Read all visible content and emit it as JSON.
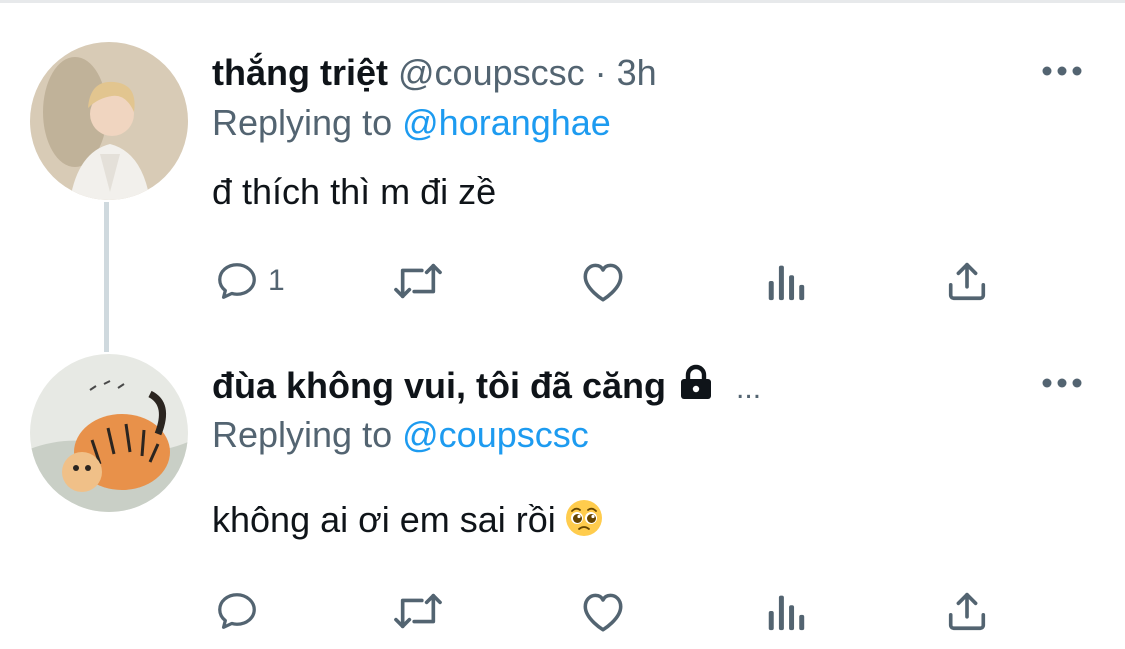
{
  "tweets": [
    {
      "display_name": "thắng triệt",
      "handle": "@coupscsc",
      "separator": "·",
      "time": "3h",
      "replying_prefix": "Replying to",
      "replying_to": "@horanghae",
      "text": "đ thích thì m đi zề",
      "reply_count": "1"
    },
    {
      "display_name": "đùa không vui, tôi đã căng",
      "name_overflow": "...",
      "replying_prefix": "Replying to",
      "replying_to": "@coupscsc",
      "text": "không ai ơi em sai rồi"
    }
  ],
  "icons": {
    "more": "more-horizontal-icon",
    "reply": "reply-icon",
    "retweet": "retweet-icon",
    "like": "heart-icon",
    "views": "analytics-icon",
    "share": "share-icon",
    "lock": "lock-icon",
    "emoji": "pleading-face-emoji"
  },
  "colors": {
    "text": "#0f1419",
    "secondary": "#536471",
    "link": "#1d9bf0",
    "divider": "#e7e9eb",
    "thread_line": "#cfd9de"
  }
}
